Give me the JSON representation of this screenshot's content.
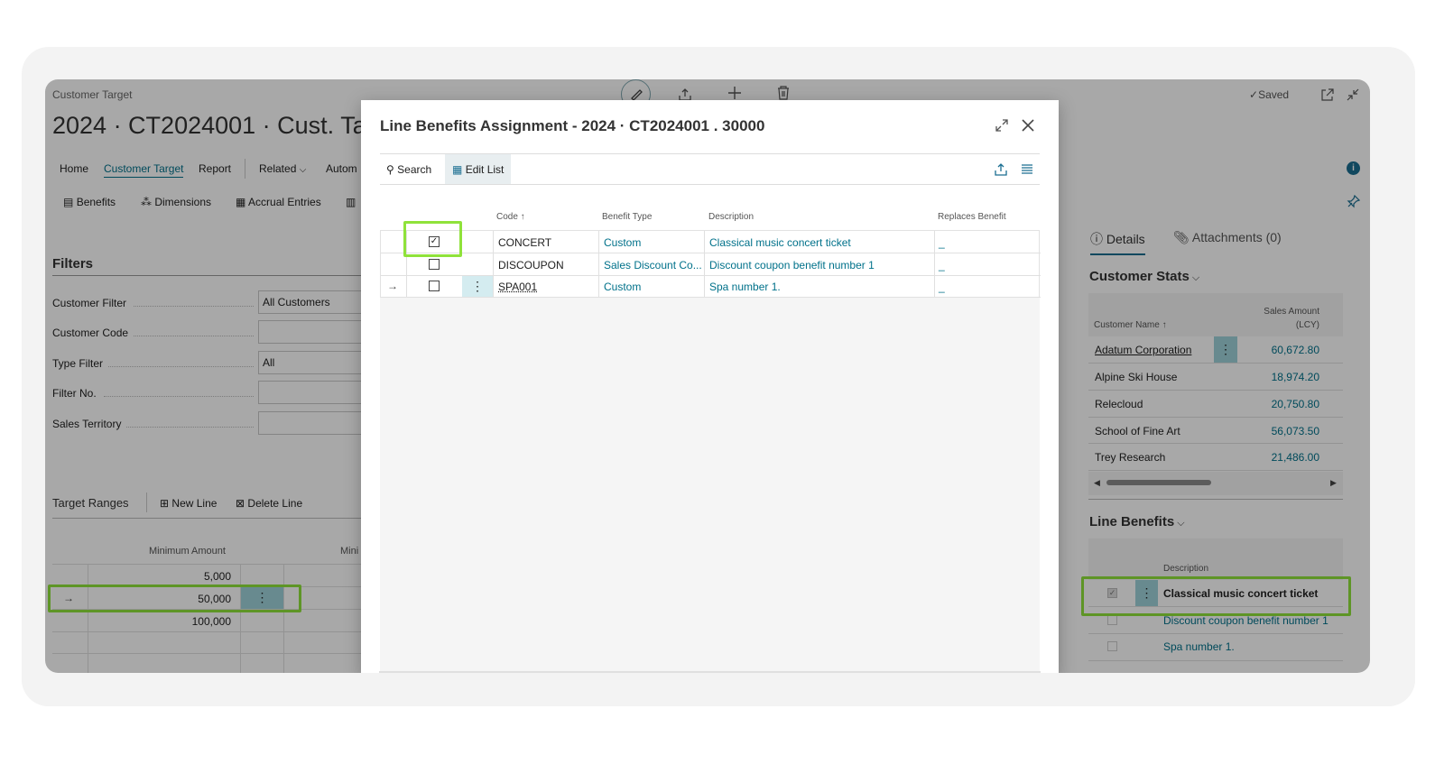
{
  "window": {
    "caption": "Customer Target",
    "title": "2024 · CT2024001 · Cust. Target",
    "saved_label": "Saved"
  },
  "nav": {
    "items": [
      "Home",
      "Customer Target",
      "Report",
      "Related",
      "Autom"
    ]
  },
  "actions": {
    "benefits": "Benefits",
    "dimensions": "Dimensions",
    "accrual": "Accrual Entries"
  },
  "filters": {
    "heading": "Filters",
    "fields": [
      {
        "label": "Customer Filter",
        "value": "All Customers"
      },
      {
        "label": "Customer Code",
        "value": ""
      },
      {
        "label": "Type Filter",
        "value": "All"
      },
      {
        "label": "Filter No.",
        "value": ""
      },
      {
        "label": "Sales Territory",
        "value": ""
      }
    ]
  },
  "ranges": {
    "heading": "Target Ranges",
    "new_line": "New Line",
    "delete_line": "Delete Line",
    "col_min_amount": "Minimum Amount",
    "col_min_partial": "Mini",
    "rows": [
      "5,000",
      "50,000",
      "100,000"
    ]
  },
  "factbox": {
    "tab_details": "Details",
    "tab_attachments": "Attachments (0)",
    "customer_stats": {
      "heading": "Customer Stats",
      "col_name": "Customer Name ↑",
      "col_amount_line1": "Sales Amount",
      "col_amount_line2": "(LCY)",
      "rows": [
        {
          "name": "Adatum Corporation",
          "amount": "60,672.80"
        },
        {
          "name": "Alpine Ski House",
          "amount": "18,974.20"
        },
        {
          "name": "Relecloud",
          "amount": "20,750.80"
        },
        {
          "name": "School of Fine Art",
          "amount": "56,073.50"
        },
        {
          "name": "Trey Research",
          "amount": "21,486.00"
        }
      ]
    },
    "line_benefits": {
      "heading": "Line Benefits",
      "col_description": "Description",
      "rows": [
        {
          "description": "Classical music concert ticket",
          "checked": true
        },
        {
          "description": "Discount coupon benefit number 1",
          "checked": false
        },
        {
          "description": "Spa number 1.",
          "checked": false
        }
      ]
    }
  },
  "dialog": {
    "title": "Line Benefits Assignment - 2024 · CT2024001 . 30000",
    "search": "Search",
    "edit_list": "Edit List",
    "columns": {
      "code": "Code ↑",
      "benefit_type": "Benefit Type",
      "description": "Description",
      "replaces": "Replaces Benefit"
    },
    "rows": [
      {
        "code": "CONCERT",
        "type": "Custom",
        "description": "Classical music concert ticket",
        "replaces": "_",
        "checked": true
      },
      {
        "code": "DISCOUPON",
        "type": "Sales Discount Co...",
        "description": "Discount coupon benefit number 1",
        "replaces": "_",
        "checked": false
      },
      {
        "code": "SPA001",
        "type": "Custom",
        "description": "Spa number 1.",
        "replaces": "_",
        "checked": false
      }
    ]
  },
  "colors": {
    "accent": "#00718a",
    "highlight": "#8fe23a",
    "selected_cell": "#9fd2da"
  }
}
